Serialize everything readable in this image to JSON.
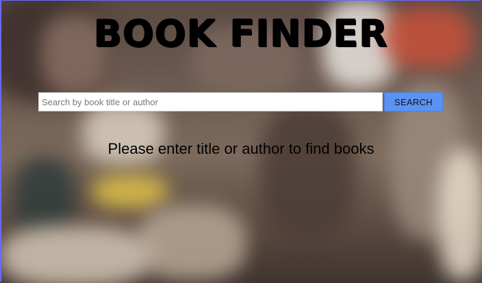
{
  "app": {
    "title": "BOOK FINDER"
  },
  "search": {
    "placeholder": "Search by book title or author",
    "value": "",
    "button_label": "SEARCH"
  },
  "message": {
    "text": "Please enter title or author to find books"
  },
  "colors": {
    "button_bg": "#5b93f2",
    "text": "#000000"
  }
}
